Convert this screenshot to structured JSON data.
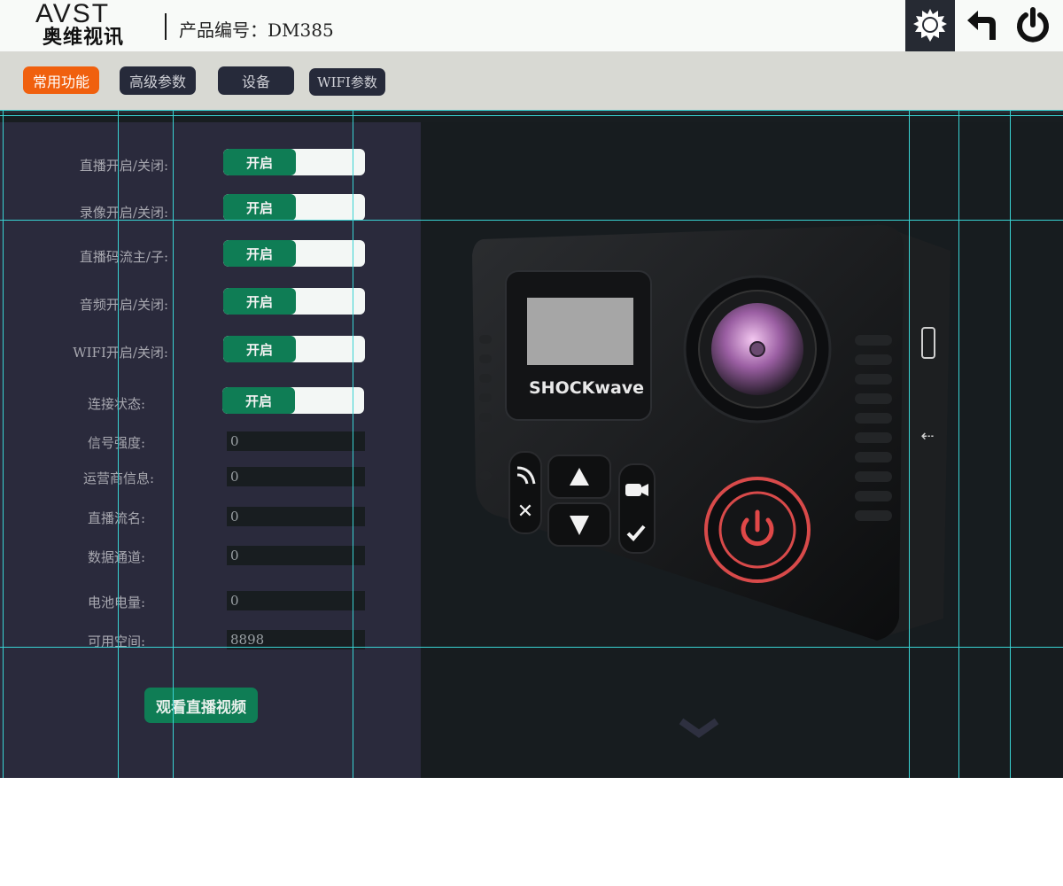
{
  "header": {
    "logo_text": "AVST",
    "logo_subtext": "奥维视讯",
    "product_label": "产品编号：DM385",
    "icons": [
      "gear-icon",
      "back-arrow-icon",
      "power-icon"
    ]
  },
  "tabs": [
    {
      "label": "常用功能",
      "active": true
    },
    {
      "label": "高级参数",
      "active": false
    },
    {
      "label": "设备",
      "active": false
    },
    {
      "label": "WIFI参数",
      "active": false
    }
  ],
  "toggles": [
    {
      "label": "直播开启/关闭:",
      "state": "开启"
    },
    {
      "label": "录像开启/关闭:",
      "state": "开启"
    },
    {
      "label": "直播码流主/子:",
      "state": "开启"
    },
    {
      "label": "音频开启/关闭:",
      "state": "开启"
    },
    {
      "label": "WIFI开启/关闭:",
      "state": "开启"
    },
    {
      "label": "连接状态:",
      "state": "开启"
    }
  ],
  "fields": [
    {
      "label": "信号强度:",
      "value": "0"
    },
    {
      "label": "运营商信息:",
      "value": "0"
    },
    {
      "label": "直播流名:",
      "value": "0"
    },
    {
      "label": "数据通道:",
      "value": "0"
    },
    {
      "label": "电池电量:",
      "value": "0"
    },
    {
      "label": "可用空间:",
      "value": "8898"
    }
  ],
  "watch_button": "观看直播视频",
  "camera": {
    "brand": "SHOCKWAVE",
    "brand_display": "SHOCKwave"
  },
  "colors": {
    "accent_orange": "#f0600e",
    "toggle_green": "#0f7d55",
    "panel_dark": "#2a2a3c",
    "guide_cyan": "#39d3d3"
  }
}
